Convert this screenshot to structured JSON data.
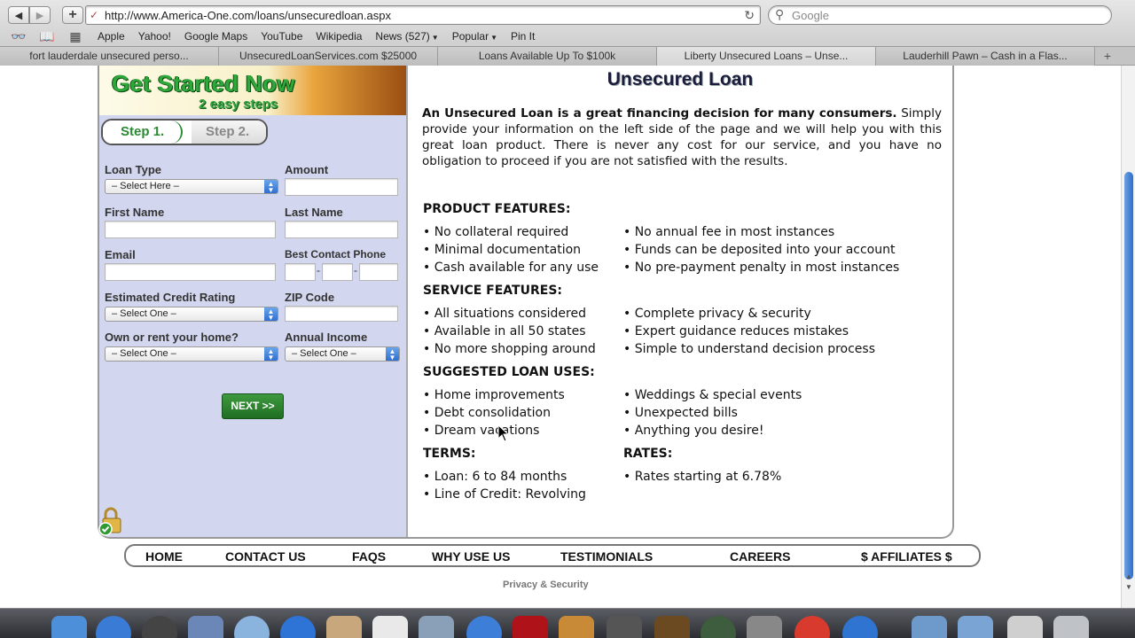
{
  "browser": {
    "url": "http://www.America-One.com/loans/unsecuredloan.aspx",
    "search_placeholder": "Google",
    "bookmarks": [
      "Apple",
      "Yahoo!",
      "Google Maps",
      "YouTube",
      "Wikipedia",
      "News (527)",
      "Popular",
      "Pin It"
    ],
    "tabs": [
      "fort lauderdale unsecured perso...",
      "UnsecuredLoanServices.com $25000",
      "Loans Available Up To $100k",
      "Liberty Unsecured Loans – Unse...",
      "Lauderhill Pawn – Cash in a Flas..."
    ]
  },
  "banner": {
    "title": "Get Started Now",
    "subtitle": "2 easy steps",
    "step1": "Step 1.",
    "step2": "Step 2."
  },
  "form": {
    "loan_type_label": "Loan Type",
    "loan_type_value": "– Select Here –",
    "amount_label": "Amount",
    "first_name_label": "First Name",
    "last_name_label": "Last Name",
    "email_label": "Email",
    "phone_label": "Best Contact Phone",
    "credit_label": "Estimated Credit Rating",
    "credit_value": "– Select One –",
    "zip_label": "ZIP Code",
    "own_rent_label": "Own or rent your home?",
    "own_rent_value": "– Select One –",
    "income_label": "Annual Income",
    "income_value": "– Select One –",
    "next_label": "NEXT >>"
  },
  "content": {
    "title": "Unsecured Loan",
    "intro_bold": "An Unsecured Loan is a great financing decision for many consumers.",
    "intro_rest": " Simply provide your information on the left side of the page and we will help you with this great loan product. There is never any cost for our service, and you have no obligation to proceed if you are not satisfied with the results.",
    "product_head": "PRODUCT FEATURES:",
    "product_col1": [
      "• No collateral required",
      "• Minimal documentation",
      "• Cash available for any use"
    ],
    "product_col2": [
      "• No annual fee in most instances",
      "• Funds can be deposited into your account",
      "• No pre-payment penalty in most instances"
    ],
    "service_head": "SERVICE FEATURES:",
    "service_col1": [
      "• All situations considered",
      "• Available in all 50 states",
      "• No more shopping around"
    ],
    "service_col2": [
      "• Complete privacy & security",
      "• Expert guidance reduces mistakes",
      "• Simple to understand decision process"
    ],
    "uses_head": "SUGGESTED LOAN USES:",
    "uses_col1": [
      "• Home improvements",
      "• Debt consolidation",
      "• Dream vacations"
    ],
    "uses_col2": [
      "• Weddings & special events",
      "• Unexpected bills",
      "• Anything you desire!"
    ],
    "terms_head": "TERMS:",
    "terms_items": [
      "• Loan: 6 to 84 months",
      "• Line of Credit: Revolving"
    ],
    "rates_head": "RATES:",
    "rates_items": [
      "• Rates starting at 6.78%"
    ]
  },
  "footer": {
    "nav": [
      "HOME",
      "CONTACT US",
      "FAQS",
      "WHY USE US",
      "TESTIMONIALS",
      "CAREERS",
      "$ AFFILIATES $"
    ],
    "privacy": "Privacy & Security"
  },
  "colors": {
    "banner_green": "#2ea83a",
    "form_bg": "#d2d6ee",
    "next_button": "#2a7f2c",
    "scroll_thumb": "#2d6fcc"
  }
}
